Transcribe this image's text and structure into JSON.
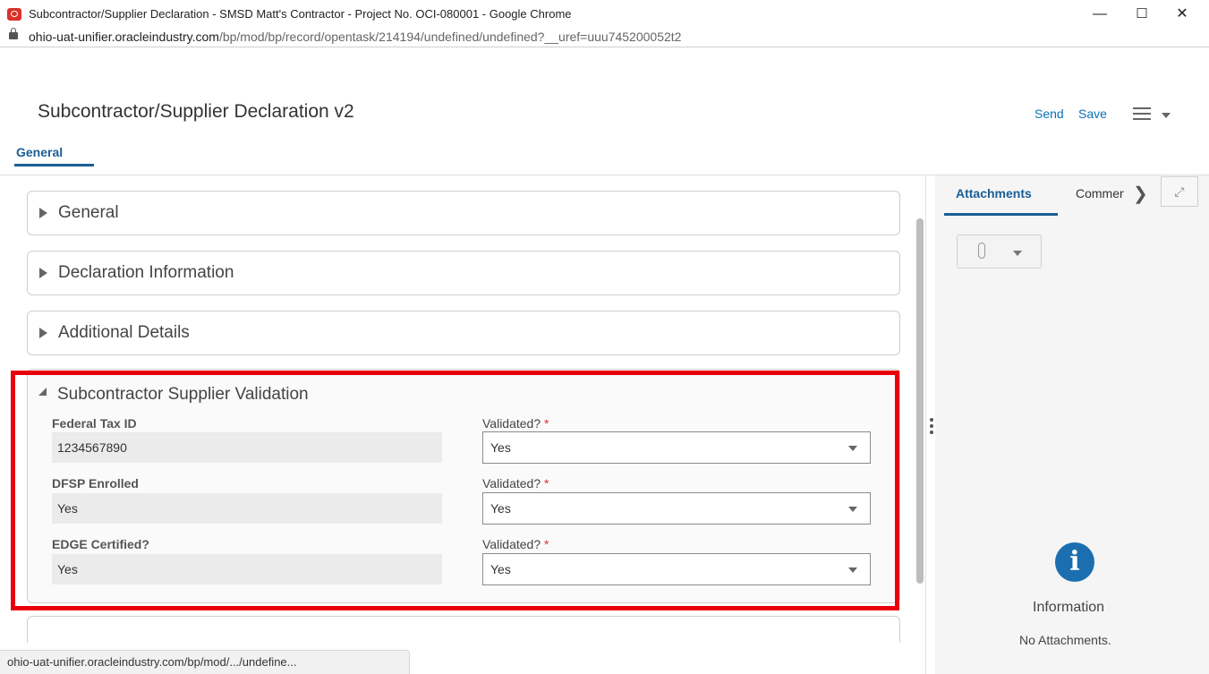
{
  "window": {
    "title": "Subcontractor/Supplier Declaration - SMSD Matt's Contractor - Project No. OCI-080001 - Google Chrome",
    "controls": {
      "minimize": "—",
      "maximize": "☐",
      "close": "✕"
    }
  },
  "address_bar": {
    "domain": "ohio-uat-unifier.oracleindustry.com",
    "path": "/bp/mod/bp/record/opentask/214194/undefined/undefined?__uref=uuu745200052t2"
  },
  "header": {
    "title": "Subcontractor/Supplier Declaration v2",
    "send_label": "Send",
    "save_label": "Save"
  },
  "tabs": [
    {
      "label": "General",
      "active": true
    }
  ],
  "sections": [
    {
      "title": "General",
      "expanded": false
    },
    {
      "title": "Declaration Information",
      "expanded": false
    },
    {
      "title": "Additional Details",
      "expanded": false
    }
  ],
  "validation_section": {
    "title": "Subcontractor Supplier Validation",
    "fields": [
      {
        "label": "Federal Tax ID",
        "value": "1234567890",
        "validated_label": "Validated?",
        "required_mark": "*",
        "validated_value": "Yes"
      },
      {
        "label": "DFSP Enrolled",
        "value": "Yes",
        "validated_label": "Validated?",
        "required_mark": "*",
        "validated_value": "Yes"
      },
      {
        "label": "EDGE Certified?",
        "value": "Yes",
        "validated_label": "Validated?",
        "required_mark": "*",
        "validated_value": "Yes"
      }
    ]
  },
  "right_panel": {
    "tabs": {
      "attachments": "Attachments",
      "comments": "Comments"
    },
    "info_title": "Information",
    "info_message": "No Attachments."
  },
  "status_bar": {
    "url": "ohio-uat-unifier.oracleindustry.com/bp/mod/.../undefine..."
  },
  "colors": {
    "accent": "#1a5e96",
    "link": "#0a70b5",
    "highlight": "#e8000d",
    "info": "#1b6fb0"
  }
}
